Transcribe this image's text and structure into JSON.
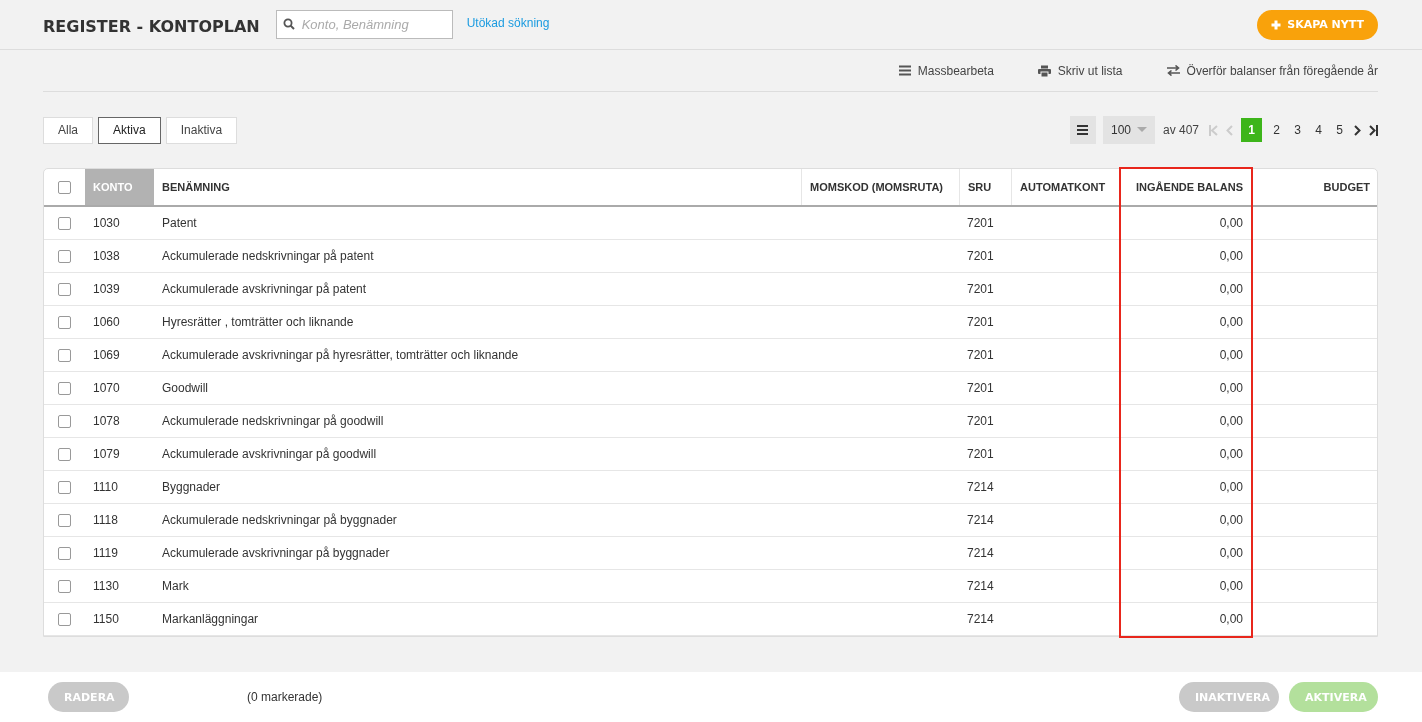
{
  "header": {
    "title": "REGISTER - KONTOPLAN",
    "search": {
      "placeholder": "Konto, Benämning"
    },
    "advanced_search": "Utökad sökning",
    "create_button": "SKAPA NYTT"
  },
  "toolbar": [
    {
      "kind": "menu",
      "label": "Massbearbeta"
    },
    {
      "kind": "print",
      "label": "Skriv ut lista"
    },
    {
      "kind": "transfer",
      "label": "Överför balanser från föregående år"
    }
  ],
  "filters": [
    {
      "label": "Alla",
      "selected": false
    },
    {
      "label": "Aktiva",
      "selected": true
    },
    {
      "label": "Inaktiva",
      "selected": false
    }
  ],
  "pagination": {
    "per_page": "100",
    "total": "av 407",
    "pages": [
      {
        "label": "1",
        "selected": true
      },
      {
        "label": "2",
        "selected": false
      },
      {
        "label": "3",
        "selected": false
      },
      {
        "label": "4",
        "selected": false
      },
      {
        "label": "5",
        "selected": false
      }
    ]
  },
  "table": {
    "select_all_checked": false,
    "columns": [
      {
        "label": "KONTO",
        "sorted": true,
        "highlighted": false
      },
      {
        "label": "BENÄMNING",
        "sorted": false,
        "highlighted": false
      },
      {
        "label": "MOMSKOD (MOMSRUTA)",
        "sorted": false,
        "highlighted": false
      },
      {
        "label": "SRU",
        "sorted": false,
        "highlighted": false
      },
      {
        "label": "AUTOMATKONT",
        "sorted": false,
        "highlighted": false
      },
      {
        "label": "INGÅENDE BALANS",
        "sorted": false,
        "highlighted": true
      },
      {
        "label": "BUDGET",
        "sorted": false,
        "highlighted": false
      }
    ],
    "rows": [
      {
        "checked": false,
        "konto": "1030",
        "name": "Patent",
        "sru": "7201",
        "balance": "0,00"
      },
      {
        "checked": false,
        "konto": "1038",
        "name": "Ackumulerade nedskrivningar på patent",
        "sru": "7201",
        "balance": "0,00"
      },
      {
        "checked": false,
        "konto": "1039",
        "name": "Ackumulerade avskrivningar på patent",
        "sru": "7201",
        "balance": "0,00"
      },
      {
        "checked": false,
        "konto": "1060",
        "name": "Hyresrätter , tomträtter och liknande",
        "sru": "7201",
        "balance": "0,00"
      },
      {
        "checked": false,
        "konto": "1069",
        "name": "Ackumulerade avskrivningar på hyresrätter, tomträtter och liknande",
        "sru": "7201",
        "balance": "0,00"
      },
      {
        "checked": false,
        "konto": "1070",
        "name": "Goodwill",
        "sru": "7201",
        "balance": "0,00"
      },
      {
        "checked": false,
        "konto": "1078",
        "name": "Ackumulerade nedskrivningar på goodwill",
        "sru": "7201",
        "balance": "0,00"
      },
      {
        "checked": false,
        "konto": "1079",
        "name": "Ackumulerade avskrivningar på goodwill",
        "sru": "7201",
        "balance": "0,00"
      },
      {
        "checked": false,
        "konto": "1110",
        "name": "Byggnader",
        "sru": "7214",
        "balance": "0,00"
      },
      {
        "checked": false,
        "konto": "1118",
        "name": "Ackumulerade nedskrivningar på byggnader",
        "sru": "7214",
        "balance": "0,00"
      },
      {
        "checked": false,
        "konto": "1119",
        "name": "Ackumulerade avskrivningar på byggnader",
        "sru": "7214",
        "balance": "0,00"
      },
      {
        "checked": false,
        "konto": "1130",
        "name": "Mark",
        "sru": "7214",
        "balance": "0,00"
      },
      {
        "checked": false,
        "konto": "1150",
        "name": "Markanläggningar",
        "sru": "7214",
        "balance": "0,00"
      }
    ]
  },
  "footer": {
    "delete_button": {
      "label": "RADERA",
      "disabled": true
    },
    "selected_count": "(0 markerade)",
    "deactivate_button": {
      "label": "INAKTIVERA",
      "disabled": true
    },
    "activate_button": {
      "label": "AKTIVERA",
      "disabled": true
    }
  }
}
